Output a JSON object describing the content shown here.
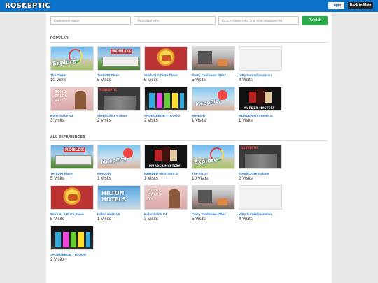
{
  "header": {
    "logo_text": "ROSKEPTIC",
    "login_label": "Login",
    "back_label": "Back to Main"
  },
  "form": {
    "name_placeholder": "Experience Name",
    "thumb_placeholder": "Thumbnail URL",
    "url_placeholder": "ECS:R Game URL (e.g. ecsr.io/games/79)",
    "publish_label": "Publish"
  },
  "popular": {
    "title": "POPULAR",
    "items": [
      {
        "name": "The Plaza!",
        "visits": "10 Visits"
      },
      {
        "name": "Test URI Place",
        "visits": "5 Visits"
      },
      {
        "name": "Work At A Pizza Place",
        "visits": "5 Visits"
      },
      {
        "name": "Crazy Funhouse Obby",
        "visits": "5 Visits"
      },
      {
        "name": "Kitty hunted mansion",
        "visits": "4 Visits"
      },
      {
        "name": "Boho Salon V4",
        "visits": "3 Visits"
      },
      {
        "name": "skeptic.luke's place",
        "visits": "2 Visits"
      },
      {
        "name": "SPONGEBOB TYCOON",
        "visits": "2 Visits"
      },
      {
        "name": "Meepcity",
        "visits": "1 Visits"
      },
      {
        "name": "MURDER MYSTERY 2!",
        "visits": "1 Visits"
      }
    ]
  },
  "all": {
    "title": "ALL EXPERIENCES",
    "items": [
      {
        "name": "Test URI Place",
        "visits": "5 Visits"
      },
      {
        "name": "Meepcity",
        "visits": "1 Visits"
      },
      {
        "name": "MURDER MYSTERY 2!",
        "visits": "1 Visits"
      },
      {
        "name": "The Plaza!",
        "visits": "10 Visits"
      },
      {
        "name": "skeptic.luke's place",
        "visits": "2 Visits"
      },
      {
        "name": "Work At A Pizza Place",
        "visits": "5 Visits"
      },
      {
        "name": "Hilton Hotel V5",
        "visits": "1 Visits"
      },
      {
        "name": "Boho Salon V4",
        "visits": "3 Visits"
      },
      {
        "name": "Crazy Funhouse Obby",
        "visits": "5 Visits"
      },
      {
        "name": "Kitty hunted mansion",
        "visits": "4 Visits"
      },
      {
        "name": "SPONGEBOB TYCOON",
        "visits": "2 Visits"
      }
    ]
  }
}
